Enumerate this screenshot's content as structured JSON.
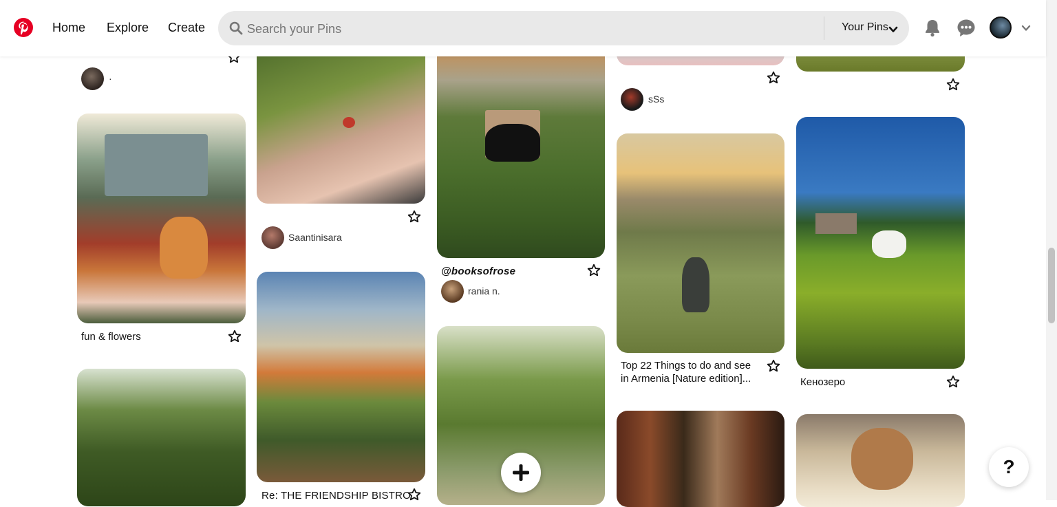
{
  "header": {
    "nav": {
      "home": "Home",
      "explore": "Explore",
      "create": "Create"
    },
    "search_placeholder": "Search your Pins",
    "your_pins": "Your Pins",
    "brand_color": "#e60023"
  },
  "pins": {
    "p1": {
      "user": "·"
    },
    "p2": {
      "title": "fun & flowers"
    },
    "p3": {
      "user": "Saantinisara"
    },
    "p4": {
      "title": "Re: THE FRIENDSHIP BISTRO"
    },
    "p5": {
      "title": "@booksofrose",
      "user": "rania n."
    },
    "p6": {
      "user": "sSs"
    },
    "p7": {
      "title": "Top 22 Things to do and see in Armenia [Nature edition]..."
    },
    "p8": {
      "title": "Кенозеро"
    }
  },
  "icons": [
    "pinterest-logo-icon",
    "search-icon",
    "chevron-down-icon",
    "bell-icon",
    "message-icon",
    "star-icon",
    "plus-icon",
    "help-icon"
  ]
}
